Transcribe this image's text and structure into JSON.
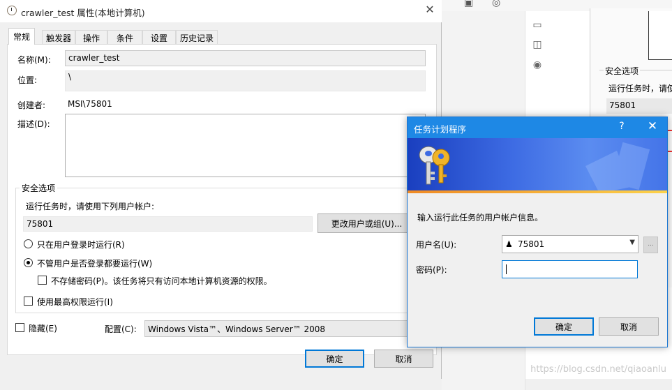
{
  "props_window": {
    "title": "crawler_test 属性(本地计算机)",
    "close_glyph": "✕",
    "tabs": [
      {
        "label": "常规",
        "active": true
      },
      {
        "label": "触发器"
      },
      {
        "label": "操作"
      },
      {
        "label": "条件"
      },
      {
        "label": "设置"
      },
      {
        "label": "历史记录"
      }
    ],
    "general": {
      "name_label": "名称(M):",
      "name_value": "crawler_test",
      "location_label": "位置:",
      "location_value": "\\",
      "author_label": "创建者:",
      "author_value": "MSI\\75801",
      "desc_label": "描述(D):",
      "desc_value": ""
    },
    "security": {
      "group_title": "安全选项",
      "run_as_text": "运行任务时，请使用下列用户帐户:",
      "user_value": "75801",
      "change_user_button": "更改用户或组(U)...",
      "radio_logged_on": "只在用户登录时运行(R)",
      "radio_whether": "不管用户是否登录都要运行(W)",
      "no_store_password": "不存储密码(P)。该任务将只有访问本地计算机资源的权限。",
      "highest_privileges": "使用最高权限运行(I)"
    },
    "hidden_label": "隐藏(E)",
    "configure_label": "配置(C):",
    "configure_value": "Windows Vista™、Windows Server™ 2008",
    "ok_button": "确定",
    "cancel_button": "取消"
  },
  "dialog": {
    "title": "任务计划程序",
    "help_glyph": "?",
    "close_glyph": "✕",
    "instruction": "输入运行此任务的用户帐户信息。",
    "username_label": "用户名(U):",
    "username_value": "75801",
    "password_label": "密码(P):",
    "password_value": "",
    "browse_glyph": "...",
    "ok_button": "确定",
    "cancel_button": "取消"
  },
  "background": {
    "security_label": "安全选项",
    "run_text": "运行任务时，请使",
    "user_value": "75801"
  },
  "watermark": "https://blog.csdn.net/qiaoanlu",
  "colors": {
    "accent": "#0078d7",
    "dialog_title": "#1e88e5",
    "arrow": "#e8392a"
  }
}
